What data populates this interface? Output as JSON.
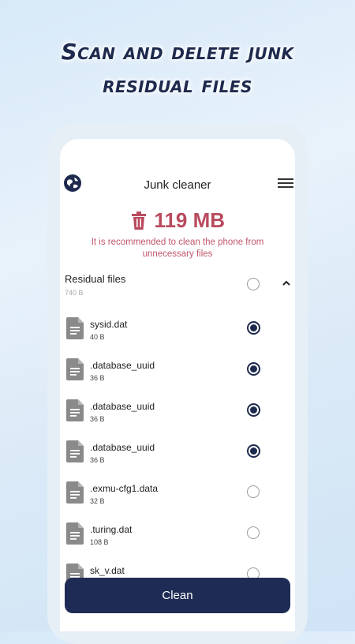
{
  "headline": {
    "line1": "Scan and delete junk",
    "line2": "residual files"
  },
  "app": {
    "title": "Junk cleaner"
  },
  "summary": {
    "size": "119 MB",
    "advice": "It is recommended to clean the phone from unnecessary files"
  },
  "group": {
    "title": "Residual files",
    "size": "740 B",
    "selected": false,
    "expanded": true
  },
  "files": [
    {
      "name": "sysid.dat",
      "size": "40 B",
      "checked": true
    },
    {
      "name": ".database_uuid",
      "size": "36 B",
      "checked": true
    },
    {
      "name": ".database_uuid",
      "size": "36 B",
      "checked": true
    },
    {
      "name": ".database_uuid",
      "size": "36 B",
      "checked": true
    },
    {
      "name": ".exmu-cfg1.data",
      "size": "32 B",
      "checked": false
    },
    {
      "name": ".turing.dat",
      "size": "108 B",
      "checked": false
    },
    {
      "name": "sk_v.dat",
      "size": "",
      "checked": false
    }
  ],
  "actions": {
    "clean_label": "Clean"
  },
  "colors": {
    "primary": "#1e2c55",
    "accent": "#b94a5e",
    "background": "#dceaf7"
  }
}
